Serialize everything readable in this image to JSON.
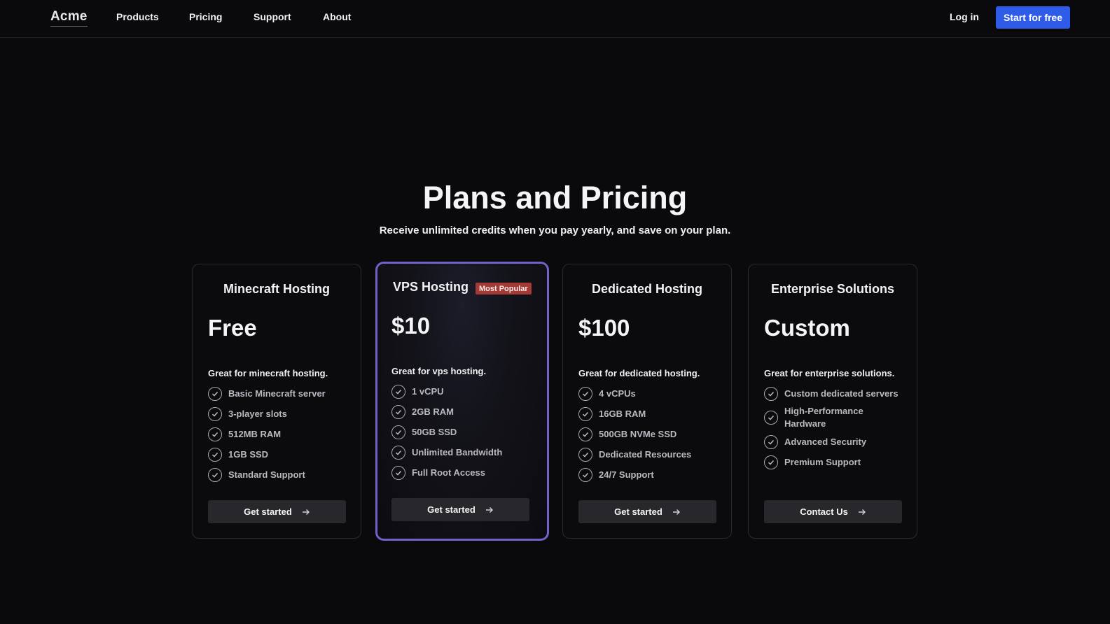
{
  "header": {
    "logo": "Acme",
    "nav": [
      "Products",
      "Pricing",
      "Support",
      "About"
    ],
    "login_label": "Log in",
    "cta_label": "Start for free",
    "cta_color": "#2f5be9"
  },
  "hero": {
    "title": "Plans and Pricing",
    "subtitle": "Receive unlimited credits when you pay yearly, and save on your plan."
  },
  "plans": [
    {
      "title": "Minecraft Hosting",
      "price": "Free",
      "description": "Great for minecraft hosting.",
      "features": [
        "Basic Minecraft server",
        "3-player slots",
        "512MB RAM",
        "1GB SSD",
        "Standard Support"
      ],
      "button": "Get started"
    },
    {
      "title": "VPS Hosting",
      "badge": "Most Popular",
      "price": "$10",
      "description": "Great for vps hosting.",
      "features": [
        "1 vCPU",
        "2GB RAM",
        "50GB SSD",
        "Unlimited Bandwidth",
        "Full Root Access"
      ],
      "button": "Get started",
      "highlight_color": "#6f63c9"
    },
    {
      "title": "Dedicated Hosting",
      "price": "$100",
      "description": "Great for dedicated hosting.",
      "features": [
        "4 vCPUs",
        "16GB RAM",
        "500GB NVMe SSD",
        "Dedicated Resources",
        "24/7 Support"
      ],
      "button": "Get started"
    },
    {
      "title": "Enterprise Solutions",
      "price": "Custom",
      "description": "Great for enterprise solutions.",
      "features": [
        "Custom dedicated servers",
        "High-Performance Hardware",
        "Advanced Security",
        "Premium Support"
      ],
      "button": "Contact Us"
    }
  ],
  "icons": {
    "feature": "check-circle-icon",
    "button": "arrow-right-icon"
  }
}
